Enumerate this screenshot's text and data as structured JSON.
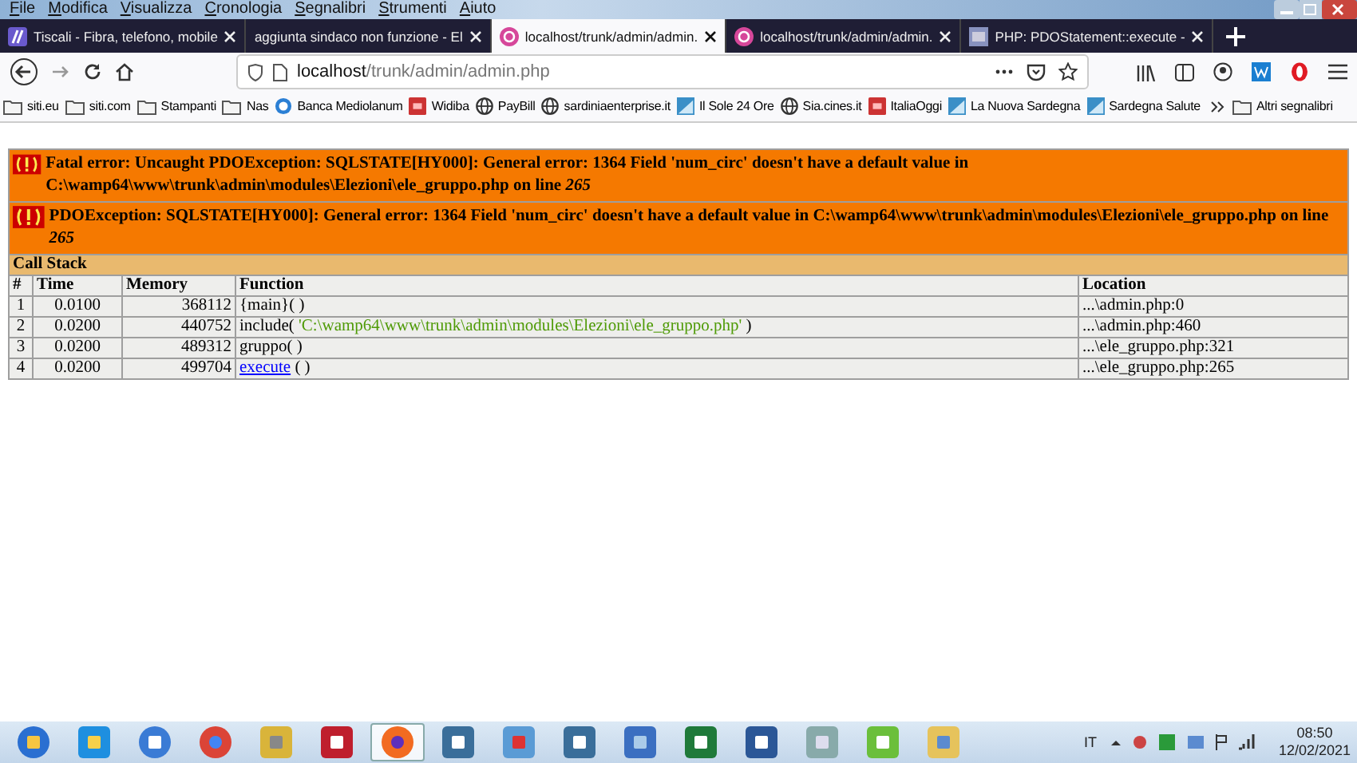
{
  "menu": [
    "File",
    "Modifica",
    "Visualizza",
    "Cronologia",
    "Segnalibri",
    "Strumenti",
    "Aiuto"
  ],
  "tabs": [
    {
      "title": "Tiscali - Fibra, telefono, mobile",
      "kind": "tiscali",
      "selected": false
    },
    {
      "title": "aggiunta sindaco non funzione - El",
      "kind": "plain",
      "selected": false
    },
    {
      "title": "localhost/trunk/admin/admin.",
      "kind": "php",
      "selected": true
    },
    {
      "title": "localhost/trunk/admin/admin.",
      "kind": "php",
      "selected": false
    },
    {
      "title": "PHP: PDOStatement::execute -",
      "kind": "doc",
      "selected": false
    }
  ],
  "address": {
    "host": "localhost",
    "path": "/trunk/admin/admin.php"
  },
  "bookmarks": [
    {
      "label": "siti.eu",
      "kind": "folder"
    },
    {
      "label": "siti.com",
      "kind": "folder"
    },
    {
      "label": "Stampanti",
      "kind": "folder"
    },
    {
      "label": "Nas",
      "kind": "folder"
    },
    {
      "label": "Banca Mediolanum",
      "kind": "circle"
    },
    {
      "label": "Widiba",
      "kind": "square"
    },
    {
      "label": "PayBill",
      "kind": "globe"
    },
    {
      "label": "sardiniaenterprise.it",
      "kind": "globe"
    },
    {
      "label": "Il Sole 24 Ore",
      "kind": "logo"
    },
    {
      "label": "Sia.cines.it",
      "kind": "globe"
    },
    {
      "label": "ItaliaOggi",
      "kind": "square"
    },
    {
      "label": "La Nuova Sardegna",
      "kind": "logo"
    },
    {
      "label": "Sardegna Salute",
      "kind": "logo"
    }
  ],
  "other_bookmarks": "Altri segnalibri",
  "errors": [
    "Fatal error: Uncaught PDOException: SQLSTATE[HY000]: General error: 1364 Field 'num_circ' doesn't have a default value in C:\\wamp64\\www\\trunk\\admin\\modules\\Elezioni\\ele_gruppo.php on line *265*",
    "PDOException: SQLSTATE[HY000]: General error: 1364 Field 'num_circ' doesn't have a default value in C:\\wamp64\\www\\trunk\\admin\\modules\\Elezioni\\ele_gruppo.php on line *265*"
  ],
  "call_stack": {
    "title": "Call Stack",
    "columns": [
      "#",
      "Time",
      "Memory",
      "Function",
      "Location"
    ],
    "rows": [
      {
        "index": "1",
        "time": "0.0100",
        "memory": "368112",
        "function": [
          {
            "kind": "plain",
            "text": "{main}( )"
          }
        ],
        "location": "...\\admin.php:0"
      },
      {
        "index": "2",
        "time": "0.0200",
        "memory": "440752",
        "function": [
          {
            "kind": "plain",
            "text": "include("
          },
          {
            "kind": "string",
            "text": "'C:\\wamp64\\www\\trunk\\admin\\modules\\Elezioni\\ele_gruppo.php'"
          },
          {
            "kind": "plain",
            "text": ")"
          }
        ],
        "location": "...\\admin.php:460"
      },
      {
        "index": "3",
        "time": "0.0200",
        "memory": "489312",
        "function": [
          {
            "kind": "plain",
            "text": "gruppo( )"
          }
        ],
        "location": "...\\ele_gruppo.php:321"
      },
      {
        "index": "4",
        "time": "0.0200",
        "memory": "499704",
        "function": [
          {
            "kind": "link",
            "text": "execute"
          },
          {
            "kind": "plain",
            "text": "( )"
          }
        ],
        "location": "...\\ele_gruppo.php:265"
      }
    ]
  },
  "taskbar": {
    "apps": [
      {
        "kind": "start",
        "selected": false
      },
      {
        "kind": "ie",
        "selected": false
      },
      {
        "kind": "mail",
        "selected": false
      },
      {
        "kind": "chrome",
        "selected": false
      },
      {
        "kind": "tools",
        "selected": false
      },
      {
        "kind": "filezilla",
        "selected": false
      },
      {
        "kind": "firefox",
        "selected": true
      },
      {
        "kind": "elephant",
        "selected": false
      },
      {
        "kind": "pdf",
        "selected": false
      },
      {
        "kind": "elephant",
        "selected": false
      },
      {
        "kind": "remote",
        "selected": false
      },
      {
        "kind": "excel",
        "selected": false
      },
      {
        "kind": "word",
        "selected": false
      },
      {
        "kind": "calculator",
        "selected": false
      },
      {
        "kind": "editor",
        "selected": false
      },
      {
        "kind": "explorer",
        "selected": false
      }
    ],
    "language": "IT",
    "time": "08:50",
    "date": "12/02/2021"
  }
}
